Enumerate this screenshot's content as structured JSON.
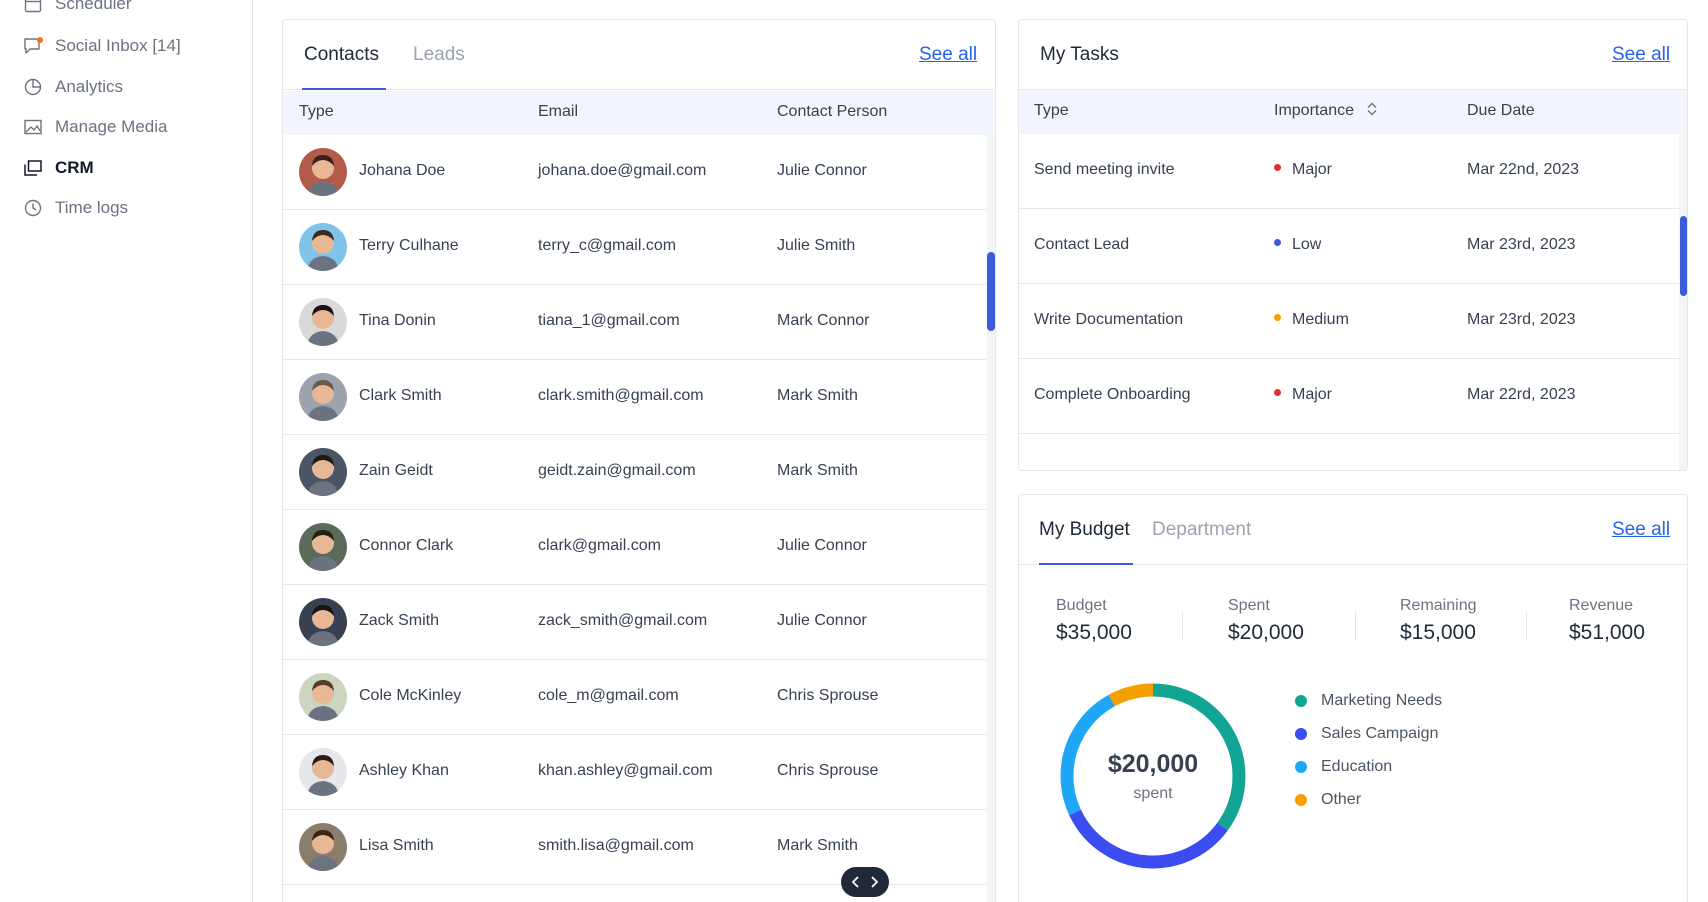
{
  "sidebar": {
    "items": [
      {
        "label": "Scheduler",
        "icon": "calendar-icon"
      },
      {
        "label": "Social Inbox [14]",
        "icon": "chat-icon"
      },
      {
        "label": "Analytics",
        "icon": "pie-chart-icon"
      },
      {
        "label": "Manage Media",
        "icon": "image-icon"
      },
      {
        "label": "CRM",
        "icon": "crm-icon",
        "active": true
      },
      {
        "label": "Time logs",
        "icon": "clock-icon"
      }
    ]
  },
  "contacts": {
    "tabs": [
      "Contacts",
      "Leads"
    ],
    "see_all": "See all",
    "columns": [
      "Type",
      "Email",
      "Contact Person"
    ],
    "rows": [
      {
        "name": "Johana Doe",
        "email": "johana.doe@gmail.com",
        "person": "Julie Connor",
        "avatar_color": "#b45a4a",
        "hair": "#3a1f1a"
      },
      {
        "name": "Terry Culhane",
        "email": "terry_c@gmail.com",
        "person": "Julie Smith",
        "avatar_color": "#7fc4e8",
        "hair": "#3b2a20"
      },
      {
        "name": "Tina Donin",
        "email": "tiana_1@gmail.com",
        "person": "Mark Connor",
        "avatar_color": "#d9d9d9",
        "hair": "#1a1210"
      },
      {
        "name": "Clark Smith",
        "email": "clark.smith@gmail.com",
        "person": "Mark Smith",
        "avatar_color": "#9ca3af",
        "hair": "#6b5a48"
      },
      {
        "name": "Zain Geidt",
        "email": "geidt.zain@gmail.com",
        "person": "Mark Smith",
        "avatar_color": "#4b5563",
        "hair": "#1f1a17"
      },
      {
        "name": "Connor Clark",
        "email": "clark@gmail.com",
        "person": "Julie Connor",
        "avatar_color": "#5b6b5a",
        "hair": "#2a1d15"
      },
      {
        "name": "Zack Smith",
        "email": "zack_smith@gmail.com",
        "person": "Julie Connor",
        "avatar_color": "#374151",
        "hair": "#1a1512"
      },
      {
        "name": "Cole McKinley",
        "email": "cole_m@gmail.com",
        "person": "Chris Sprouse",
        "avatar_color": "#cbd5c0",
        "hair": "#5a3b28"
      },
      {
        "name": "Ashley Khan",
        "email": "khan.ashley@gmail.com",
        "person": "Chris Sprouse",
        "avatar_color": "#e5e7eb",
        "hair": "#2b1c14"
      },
      {
        "name": "Lisa Smith",
        "email": "smith.lisa@gmail.com",
        "person": "Mark Smith",
        "avatar_color": "#8b7d6b",
        "hair": "#3b2418"
      }
    ]
  },
  "tasks": {
    "title": "My Tasks",
    "see_all": "See all",
    "columns": [
      "Type",
      "Importance",
      "Due Date"
    ],
    "rows": [
      {
        "type": "Send meeting invite",
        "importance": "Major",
        "color": "#e03131",
        "due": "Mar 22nd, 2023"
      },
      {
        "type": "Contact Lead",
        "importance": "Low",
        "color": "#3b5bdb",
        "due": "Mar 23rd, 2023"
      },
      {
        "type": "Write Documentation",
        "importance": "Medium",
        "color": "#f59f00",
        "due": "Mar 23rd, 2023"
      },
      {
        "type": "Complete Onboarding",
        "importance": "Major",
        "color": "#e03131",
        "due": "Mar 22rd, 2023"
      }
    ]
  },
  "budget": {
    "tabs": [
      "My Budget",
      "Department"
    ],
    "see_all": "See all",
    "stats": [
      {
        "label": "Budget",
        "value": "$35,000"
      },
      {
        "label": "Spent",
        "value": "$20,000"
      },
      {
        "label": "Remaining",
        "value": "$15,000"
      },
      {
        "label": "Revenue",
        "value": "$51,000"
      }
    ],
    "donut": {
      "center_value": "$20,000",
      "center_label": "spent",
      "segments": [
        {
          "name": "Marketing Needs",
          "color": "#12a594",
          "share": 0.35
        },
        {
          "name": "Sales Campaign",
          "color": "#3b4cf0",
          "share": 0.33
        },
        {
          "name": "Education",
          "color": "#1ea7f5",
          "share": 0.24
        },
        {
          "name": "Other",
          "color": "#f59f00",
          "share": 0.08
        }
      ]
    }
  }
}
